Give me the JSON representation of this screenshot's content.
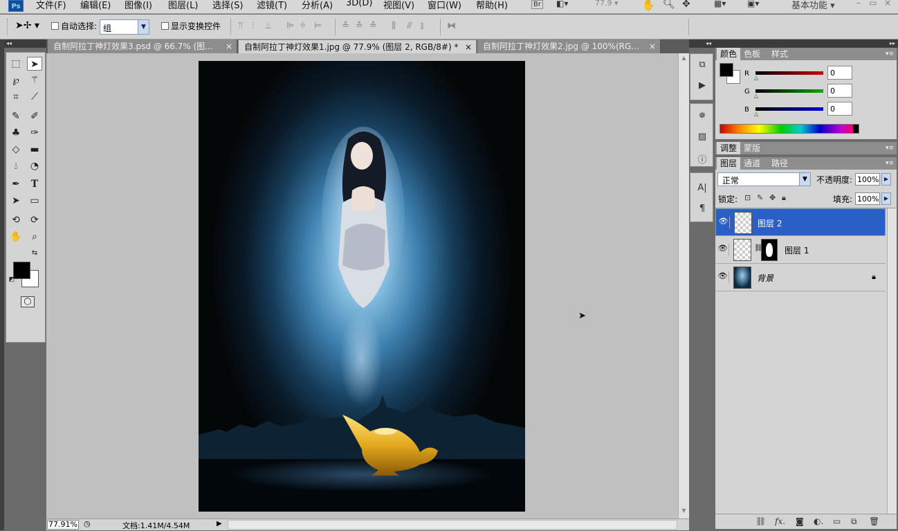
{
  "app": {
    "logo": "Ps"
  },
  "menubar": {
    "items": [
      "文件(F)",
      "编辑(E)",
      "图像(I)",
      "图层(L)",
      "选择(S)",
      "滤镜(T)",
      "分析(A)",
      "3D(D)",
      "视图(V)",
      "窗口(W)",
      "帮助(H)"
    ],
    "bridge": "Br",
    "zoom": "77.9",
    "workspace": "基本功能",
    "window_controls": [
      "–",
      "▭",
      "×"
    ]
  },
  "options": {
    "auto_select_label": "自动选择:",
    "auto_select_value": "组",
    "show_transform_label": "显示变换控件",
    "align_icons": [
      "align-top-icon",
      "align-vcenter-icon",
      "align-bottom-icon",
      "align-left-icon",
      "align-hcenter-icon",
      "align-right-icon"
    ],
    "distribute_icons": [
      "distribute-top-icon",
      "distribute-vcenter-icon",
      "distribute-bottom-icon",
      "distribute-left-icon",
      "distribute-hcenter-icon",
      "distribute-right-icon"
    ],
    "auto_align_icon": "auto-align-icon"
  },
  "tabs": [
    {
      "label": "自制阿拉丁神灯效果3.psd @ 66.7% (图...",
      "close": "×",
      "active": false
    },
    {
      "label": "自制阿拉丁神灯效果1.jpg @ 77.9% (图层 2, RGB/8#) *",
      "close": "×",
      "active": true
    },
    {
      "label": "自制阿拉丁神灯效果2.jpg @ 100%(RG...",
      "close": "×",
      "active": false
    }
  ],
  "toolbox": {
    "tools": [
      "marquee-icon",
      "move-icon",
      "lasso-icon",
      "magic-wand-icon",
      "crop-icon",
      "eyedropper-icon",
      "healing-brush-icon",
      "brush-icon",
      "clone-stamp-icon",
      "history-brush-icon",
      "eraser-icon",
      "gradient-icon",
      "blur-icon",
      "dodge-icon",
      "pen-icon",
      "type-icon",
      "path-select-icon",
      "shape-icon",
      "3d-rotate-icon",
      "3d-orbit-icon",
      "hand-icon",
      "zoom-icon"
    ],
    "type_glyph": "T",
    "foreground_color": "#000000",
    "background_color": "#ffffff"
  },
  "status": {
    "zoom": "77.91%",
    "doc": "文档:1.41M/4.54M"
  },
  "panels": {
    "color": {
      "tabs": [
        "颜色",
        "色板",
        "样式"
      ],
      "channels": [
        {
          "label": "R",
          "value": "0",
          "color": "#cc0000"
        },
        {
          "label": "G",
          "value": "0",
          "color": "#00aa00"
        },
        {
          "label": "B",
          "value": "0",
          "color": "#0000cc"
        }
      ]
    },
    "adjust": {
      "tabs": [
        "调整",
        "蒙版"
      ]
    },
    "layers": {
      "tabs": [
        "图层",
        "通道",
        "路径"
      ],
      "blend_mode": "正常",
      "opacity_label": "不透明度:",
      "opacity": "100%",
      "lock_label": "锁定:",
      "fill_label": "填充:",
      "fill": "100%",
      "items": [
        {
          "name": "图层 2",
          "selected": true,
          "mask": false,
          "locked": false
        },
        {
          "name": "图层 1",
          "selected": false,
          "mask": true,
          "locked": false
        },
        {
          "name": "背景",
          "selected": false,
          "mask": false,
          "locked": true
        }
      ],
      "footer_icons": [
        "link-layers-icon",
        "fx-icon",
        "add-mask-icon",
        "adjustment-layer-icon",
        "new-group-icon",
        "new-layer-icon",
        "delete-layer-icon"
      ]
    }
  }
}
